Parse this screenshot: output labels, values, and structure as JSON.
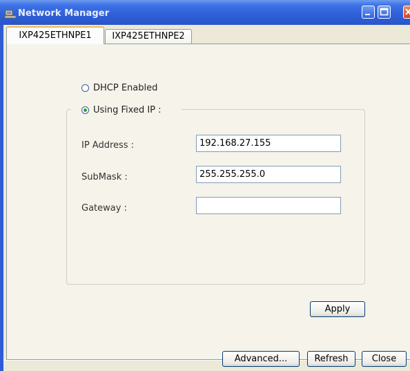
{
  "window": {
    "title": "Network Manager",
    "accent_color": "#2f5bd6",
    "controls": [
      "minimize-icon",
      "maximize-icon",
      "close-icon"
    ]
  },
  "tabs": [
    {
      "label": "IXP425ETHNPE1",
      "active": true
    },
    {
      "label": "IXP425ETHNPE2",
      "active": false
    }
  ],
  "ip_mode": {
    "dhcp_label": "DHCP Enabled",
    "fixed_label": "Using Fixed IP :",
    "selected": "fixed"
  },
  "fields": {
    "ip_label": "IP Address :",
    "ip_value": "192.168.27.155",
    "submask_label": "SubMask :",
    "submask_value": "255.255.255.0",
    "gateway_label": "Gateway :",
    "gateway_value": ""
  },
  "buttons": {
    "apply": "Apply",
    "advanced": "Advanced...",
    "refresh": "Refresh",
    "close": "Close"
  }
}
